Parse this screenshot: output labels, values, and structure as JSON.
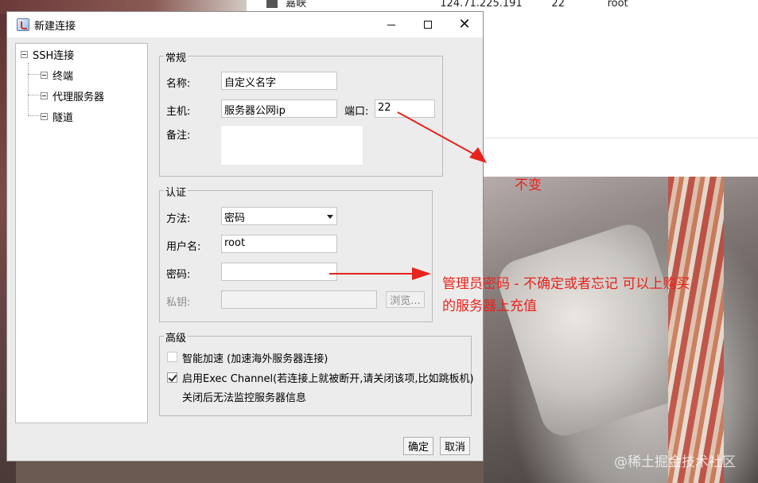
{
  "background": {
    "row": {
      "name": "嘉峡",
      "ip": "124.71.225.191",
      "port": "22",
      "user": "root"
    },
    "watermark": "@稀土掘金技术社区"
  },
  "dialog": {
    "title": "新建连接",
    "tree": {
      "root": "SSH连接",
      "children": [
        "终端",
        "代理服务器",
        "隧道"
      ]
    },
    "general": {
      "legend": "常规",
      "name_label": "名称:",
      "name_value": "自定义名字",
      "host_label": "主机:",
      "host_value": "服务器公网ip",
      "port_label": "端口:",
      "port_value": "22",
      "note_label": "备注:"
    },
    "auth": {
      "legend": "认证",
      "method_label": "方法:",
      "method_value": "密码",
      "user_label": "用户名:",
      "user_value": "root",
      "password_label": "密码:",
      "password_value": "",
      "key_label": "私钥:",
      "browse_label": "浏览..."
    },
    "advanced": {
      "legend": "高级",
      "smart_accel_label": "智能加速 (加速海外服务器连接)",
      "smart_accel_checked": false,
      "exec_channel_label": "启用Exec Channel(若连接上就被断开,请关闭该项,比如跳板机)",
      "exec_channel_checked": true,
      "exec_channel_note": "关闭后无法监控服务器信息"
    },
    "ok_label": "确定",
    "cancel_label": "取消"
  },
  "annotations": {
    "port_note": "不变",
    "password_note_line1": "管理员密码 - 不确定或者忘记 可以上购买",
    "password_note_line2": "的服务器上充值",
    "color": "#e8221c"
  }
}
